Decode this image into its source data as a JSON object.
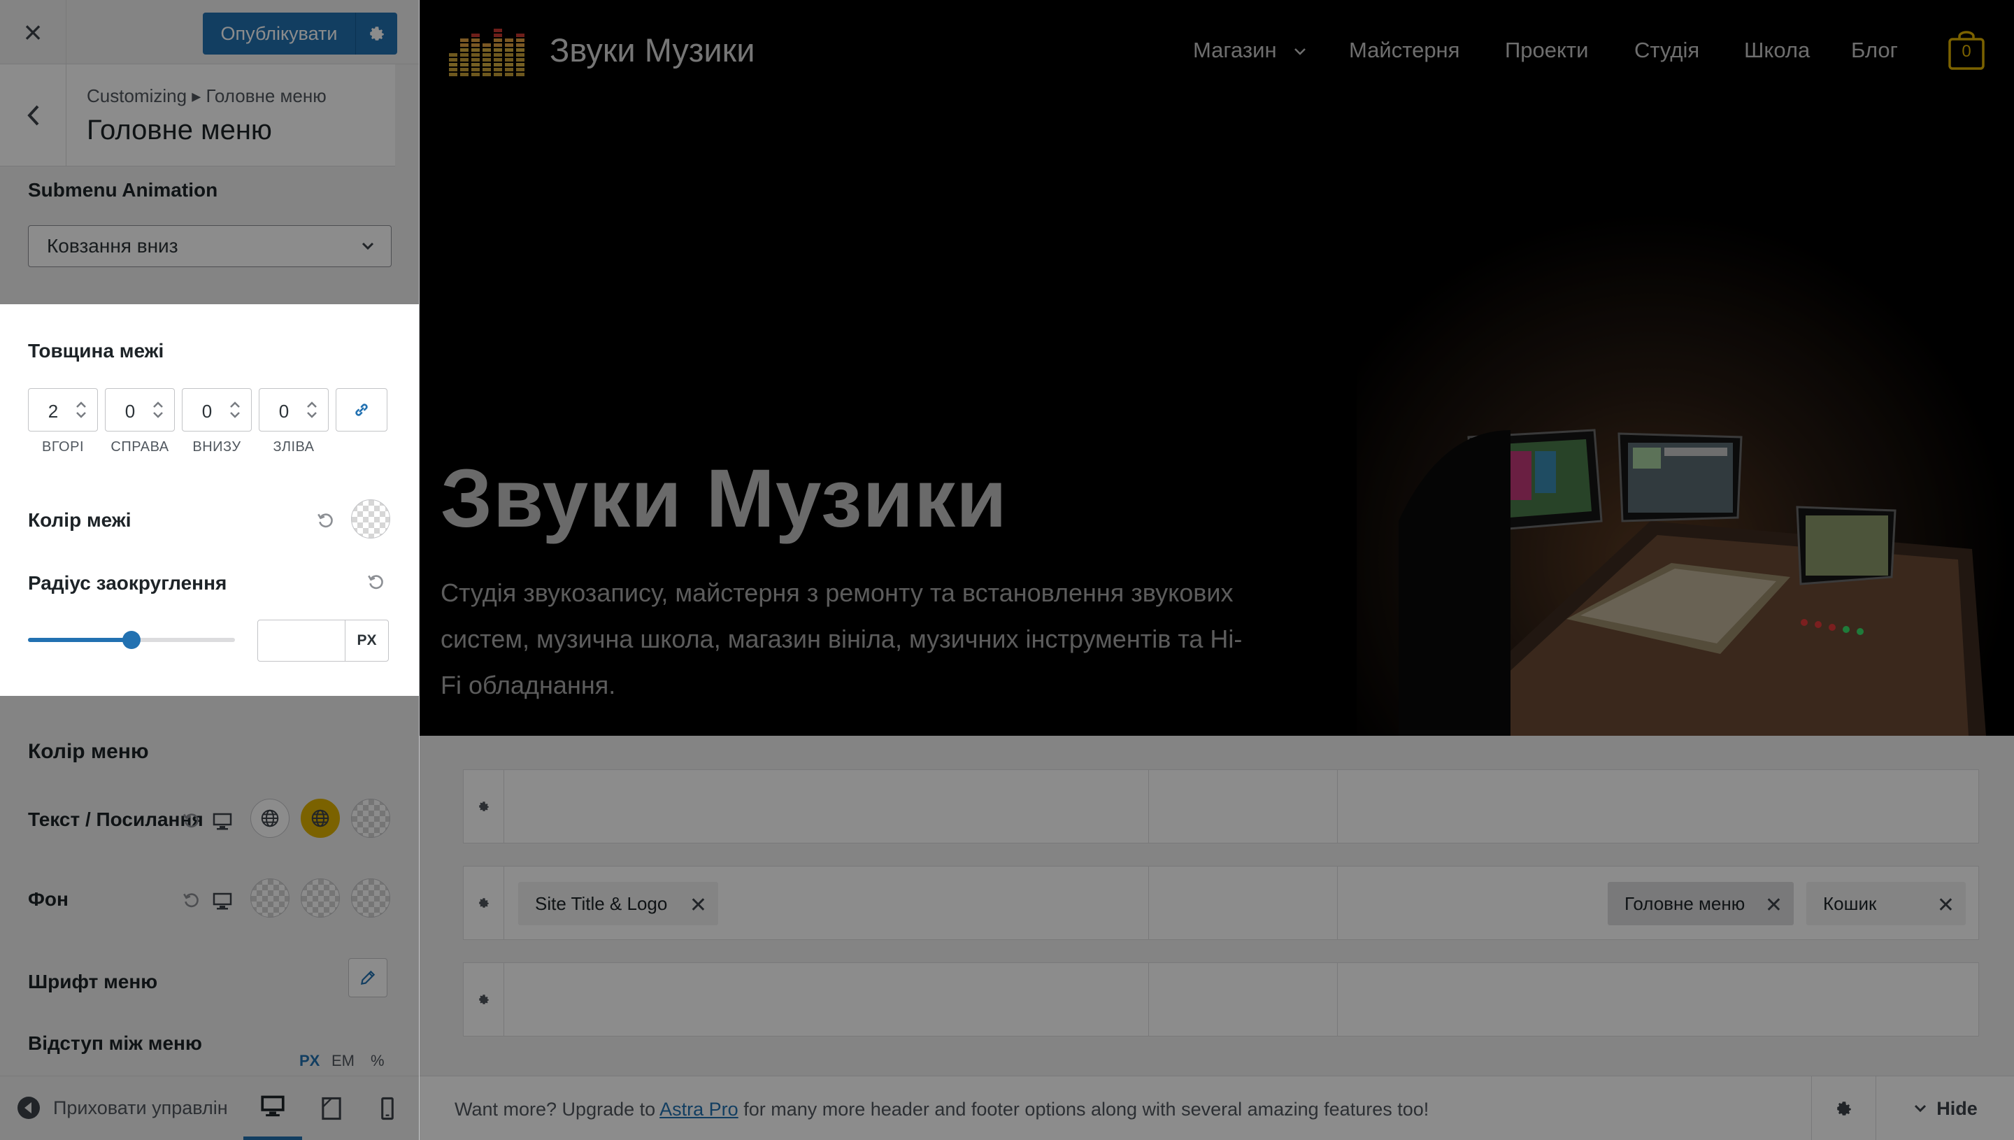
{
  "sidebar": {
    "close_label": "×",
    "publish_label": "Опублікувати",
    "breadcrumb": "Customizing ▸ Головне меню",
    "panel_title": "Головне меню",
    "submenu_animation": {
      "label": "Submenu Animation",
      "value": "Ковзання вниз"
    },
    "border_width": {
      "label": "Товщина межі",
      "fields": [
        {
          "value": "2",
          "caption": "ВГОРІ"
        },
        {
          "value": "0",
          "caption": "СПРАВА"
        },
        {
          "value": "0",
          "caption": "ВНИЗУ"
        },
        {
          "value": "0",
          "caption": "ЗЛІВА"
        }
      ]
    },
    "border_color": {
      "label": "Колір межі"
    },
    "border_radius": {
      "label": "Радіус заокруглення",
      "value": "",
      "unit": "PX",
      "slider_fraction": 0.5
    },
    "menu_color": {
      "label": "Колір меню"
    },
    "text_link": {
      "label": "Текст / Посилання"
    },
    "background": {
      "label": "Фон"
    },
    "menu_font": {
      "label": "Шрифт меню"
    },
    "menu_spacing": {
      "label": "Відступ між меню",
      "units": [
        "PX",
        "EM",
        "%"
      ]
    },
    "footer": {
      "collapse_label": "Приховати управлін"
    }
  },
  "colors": {
    "accent": "#2271b1",
    "active_swatch": "#e0b200",
    "cart": "#e0b200"
  },
  "site": {
    "title": "Звуки Музики",
    "nav": [
      "Магазин",
      "Майстерня",
      "Проекти",
      "Студія",
      "Школа",
      "Блог"
    ],
    "cart_count": "0",
    "hero_title": "Звуки Музики",
    "hero_text": "Студія звукозапису, майстерня з ремонту та встановлення звукових систем, музична школа, магазин вініла, музичних інструментів та Hi-Fi обладнання."
  },
  "builder": {
    "chips": {
      "site_title_logo": "Site Title & Logo",
      "main_menu": "Головне меню",
      "cart": "Кошик"
    },
    "upsell": {
      "before": "Want more? Upgrade to ",
      "link": "Astra Pro",
      "after": " for many more header and footer options along with several amazing features too!"
    },
    "hide_label": "Hide"
  }
}
